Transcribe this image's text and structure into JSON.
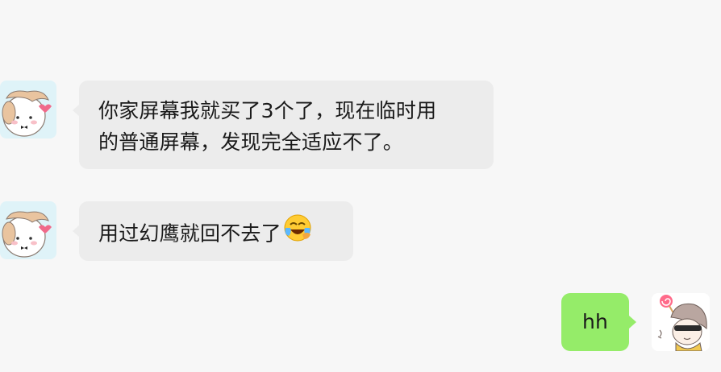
{
  "messages": [
    {
      "direction": "incoming",
      "line1": "你家屏幕我就买了3个了，现在临时用",
      "line2": "的普通屏幕，发现完全适应不了。"
    },
    {
      "direction": "incoming",
      "text": "用过幻鹰就回不去了",
      "emoji": "face-with-tears-of-joy-icon"
    },
    {
      "direction": "outgoing",
      "text": "hh"
    }
  ],
  "colors": {
    "background": "#f7f7f7",
    "incoming_bubble": "#ececec",
    "outgoing_bubble": "#95ec69",
    "text": "#1a1a1a"
  }
}
